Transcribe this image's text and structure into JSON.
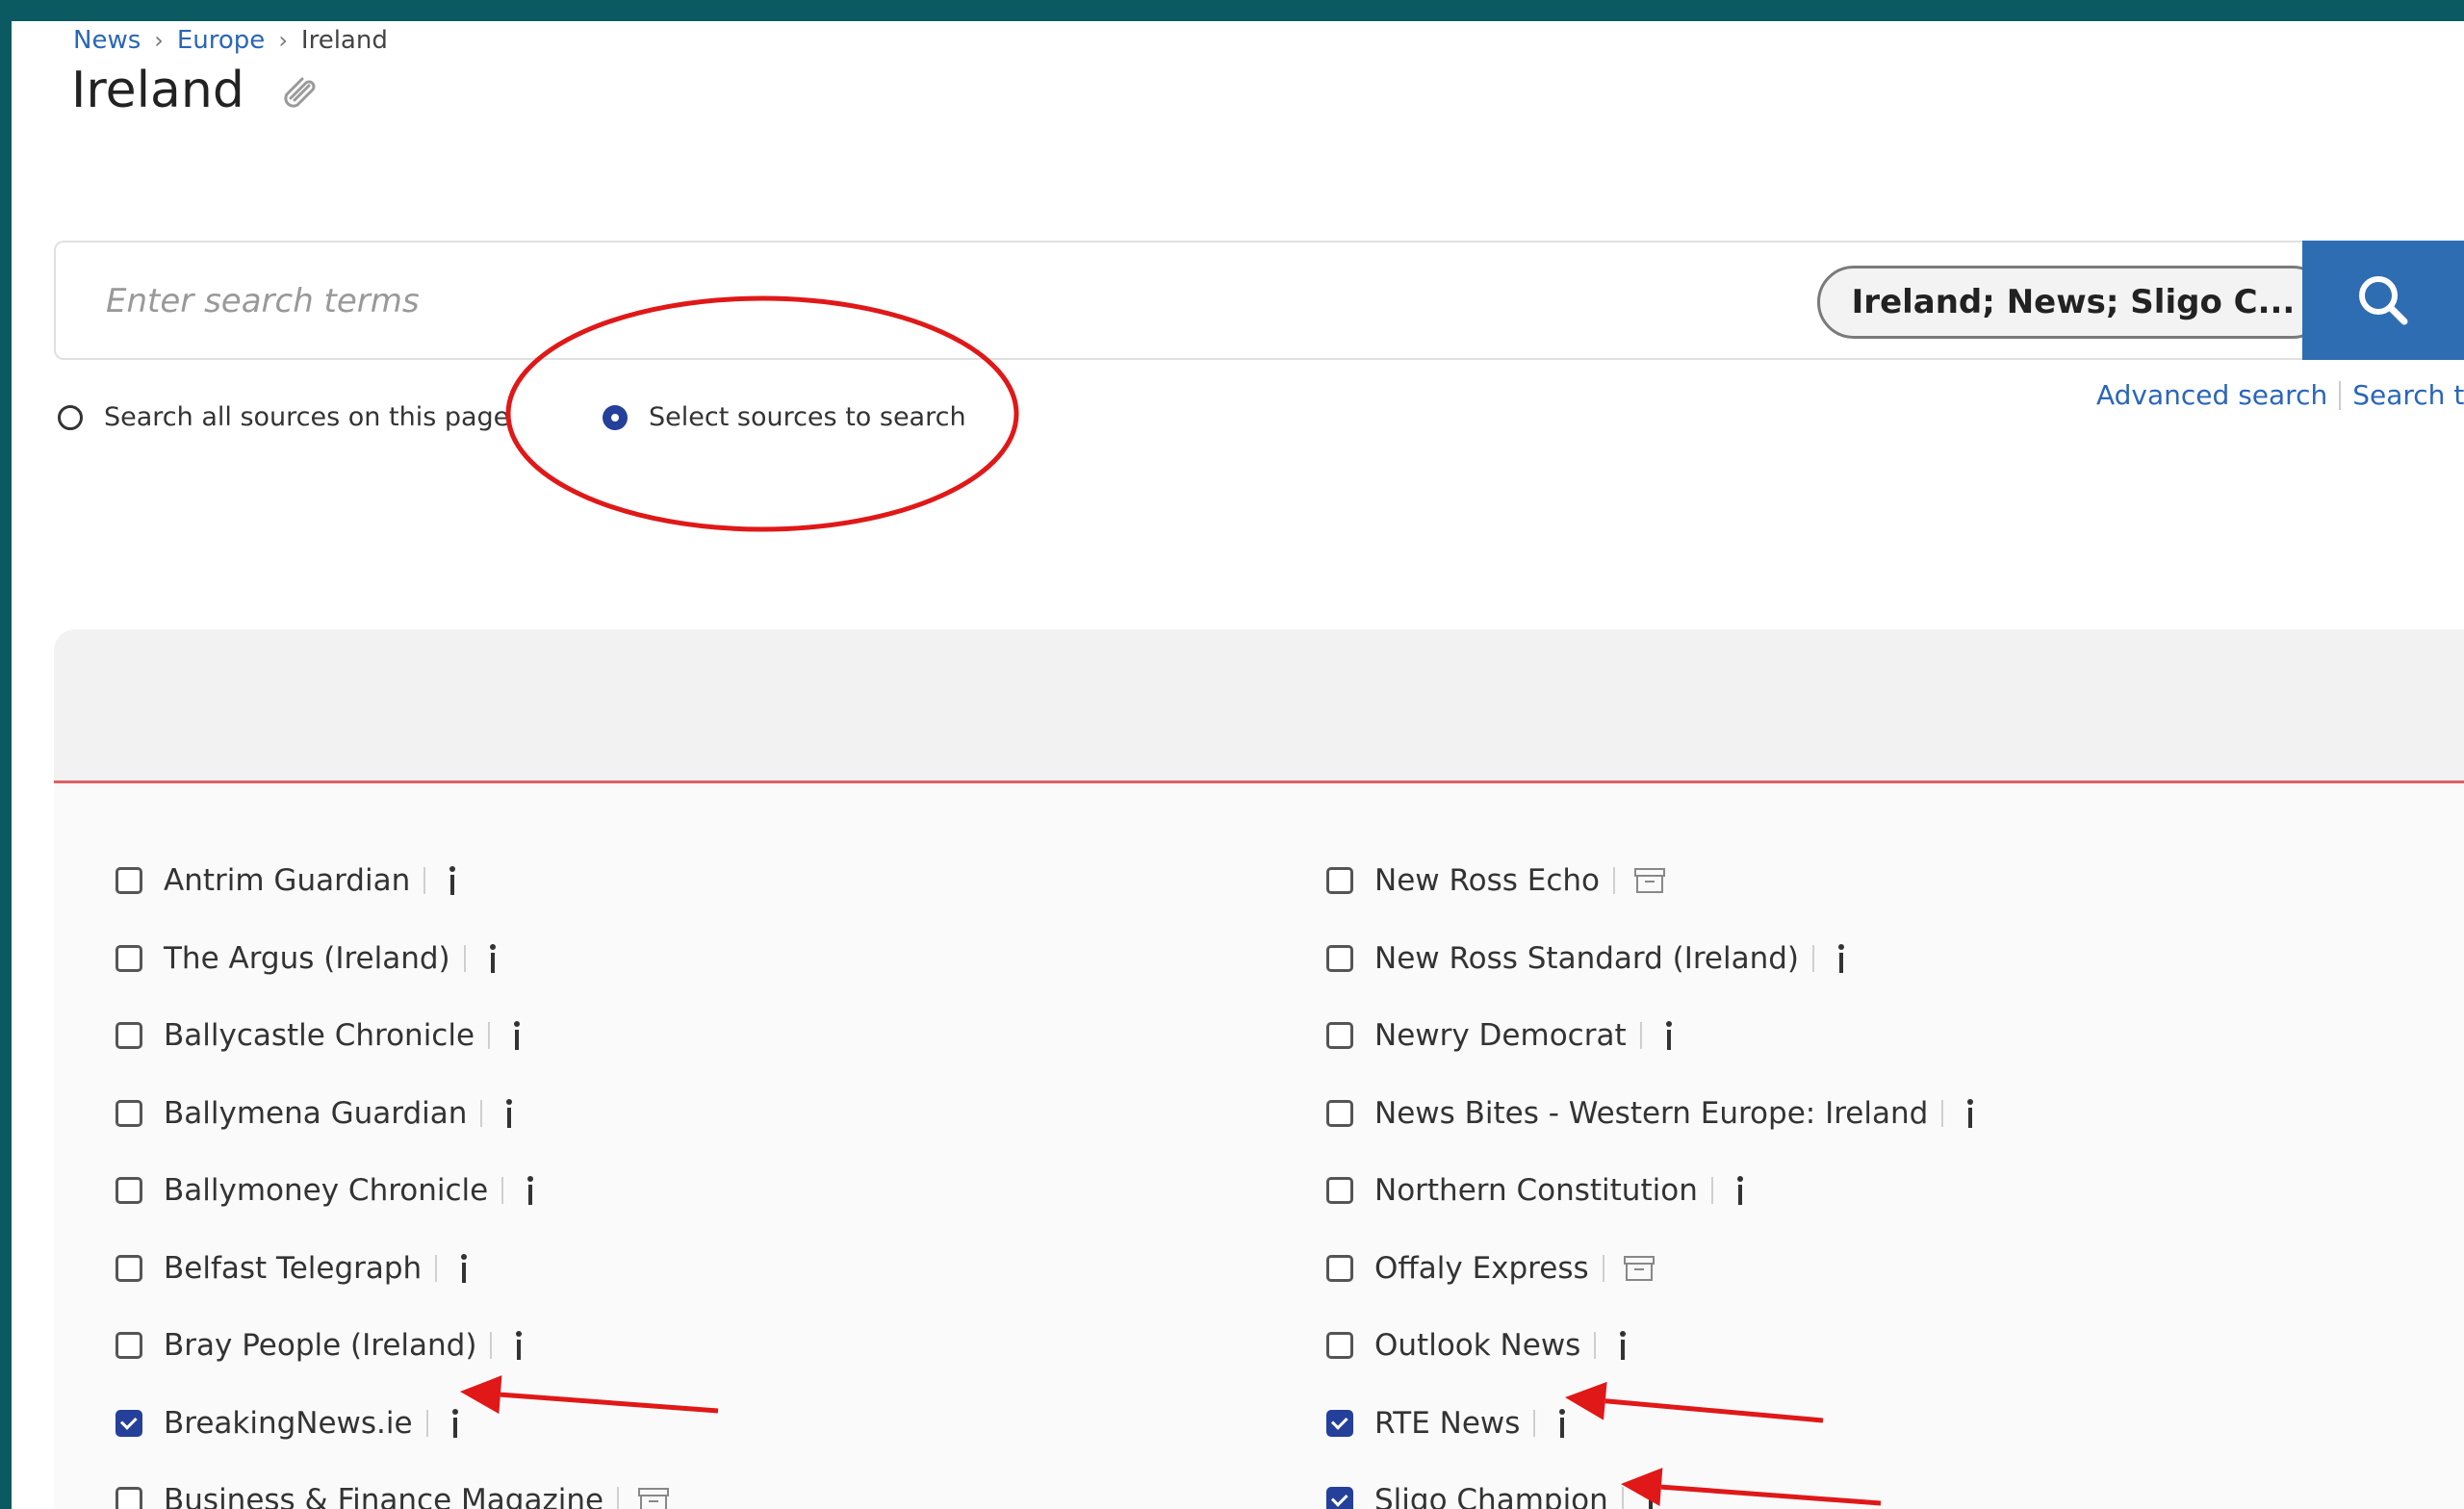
{
  "breadcrumb": {
    "items": [
      "News",
      "Europe",
      "Ireland"
    ]
  },
  "page": {
    "title": "Ireland"
  },
  "search": {
    "placeholder": "Enter search terms",
    "source_pill": "Ireland; News; Sligo C...",
    "options": [
      "Search all sources on this page",
      "Select sources to search"
    ],
    "selected_option": "Select sources to search",
    "links": [
      "Advanced search",
      "Search ti"
    ]
  },
  "sources": {
    "left": [
      {
        "name": "Antrim Guardian",
        "checked": false,
        "icon": "info-icon"
      },
      {
        "name": "The Argus (Ireland)",
        "checked": false,
        "icon": "info-icon"
      },
      {
        "name": "Ballycastle Chronicle",
        "checked": false,
        "icon": "info-icon"
      },
      {
        "name": "Ballymena Guardian",
        "checked": false,
        "icon": "info-icon"
      },
      {
        "name": "Ballymoney Chronicle",
        "checked": false,
        "icon": "info-icon"
      },
      {
        "name": "Belfast Telegraph",
        "checked": false,
        "icon": "info-icon"
      },
      {
        "name": "Bray People (Ireland)",
        "checked": false,
        "icon": "info-icon"
      },
      {
        "name": "BreakingNews.ie",
        "checked": true,
        "icon": "info-icon"
      },
      {
        "name": "Business & Finance Magazine",
        "checked": false,
        "icon": "archive-icon"
      }
    ],
    "right": [
      {
        "name": "New Ross Echo",
        "checked": false,
        "icon": "archive-icon"
      },
      {
        "name": "New Ross Standard (Ireland)",
        "checked": false,
        "icon": "info-icon"
      },
      {
        "name": "Newry Democrat",
        "checked": false,
        "icon": "info-icon"
      },
      {
        "name": "News Bites - Western Europe: Ireland",
        "checked": false,
        "icon": "info-icon"
      },
      {
        "name": "Northern Constitution",
        "checked": false,
        "icon": "info-icon"
      },
      {
        "name": "Offaly Express",
        "checked": false,
        "icon": "archive-icon"
      },
      {
        "name": "Outlook News",
        "checked": false,
        "icon": "info-icon"
      },
      {
        "name": "RTE News",
        "checked": true,
        "icon": "info-icon"
      },
      {
        "name": "Sligo Champion",
        "checked": true,
        "icon": "info-icon"
      }
    ]
  },
  "colors": {
    "accent": "#2f6db3",
    "checked": "#24409a",
    "link": "#2a66b8",
    "annotation": "#e01818",
    "frame": "#0b5a61"
  }
}
